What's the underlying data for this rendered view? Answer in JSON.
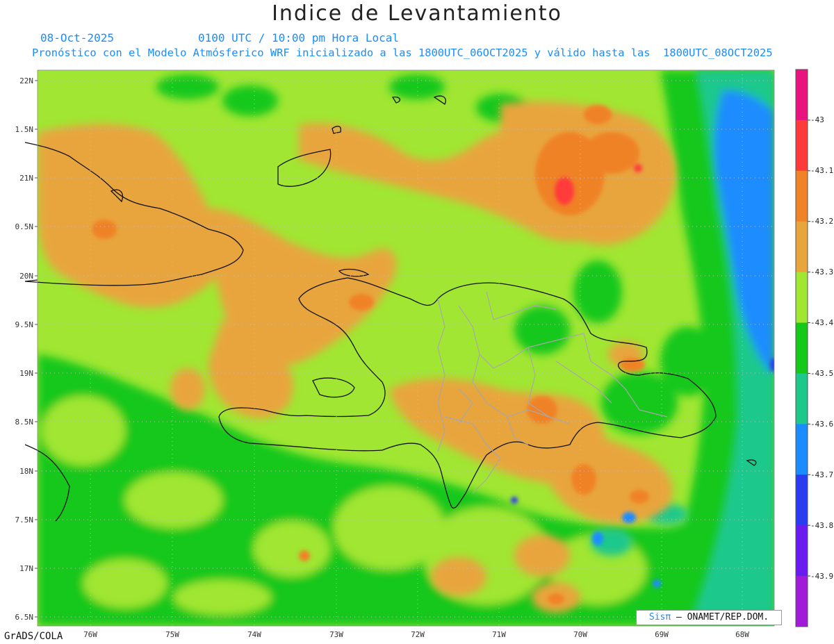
{
  "header": {
    "title": "Indice de Levantamiento",
    "date": "08-Oct-2025",
    "time": "0100 UTC / 10:00 pm Hora Local",
    "description": "Pronóstico con el Modelo Atmósferico WRF inicializado a las 1800UTC_06OCT2025 y válido hasta las  1800UTC_08OCT2025"
  },
  "map": {
    "lon_labels": [
      "76W",
      "75W",
      "74W",
      "73W",
      "72W",
      "71W",
      "70W",
      "69W",
      "68W"
    ],
    "lat_labels": [
      "22N",
      "1.5N",
      "21N",
      "0.5N",
      "20N",
      "9.5N",
      "19N",
      "8.5N",
      "18N",
      "7.5N",
      "17N",
      "6.5N"
    ],
    "field": "Lifted index (WRF), Hispaniola region"
  },
  "colorbar": {
    "labels": [
      "-43",
      "-43.1",
      "-43.2",
      "-43.3",
      "-43.4",
      "-43.5",
      "-43.6",
      "-43.7",
      "-43.8",
      "-43.9"
    ],
    "colors": [
      "#e8137f",
      "#ff3a3a",
      "#f08228",
      "#e8a53c",
      "#a0e632",
      "#16c81a",
      "#1ec88c",
      "#1a8cff",
      "#2a3cf0",
      "#6a1cf0",
      "#a01cd8"
    ]
  },
  "footer": {
    "credit": "GrADS/COLA",
    "badge_prefix": "Sisπ",
    "badge_text": "– ONAMET/REP.DOM."
  }
}
